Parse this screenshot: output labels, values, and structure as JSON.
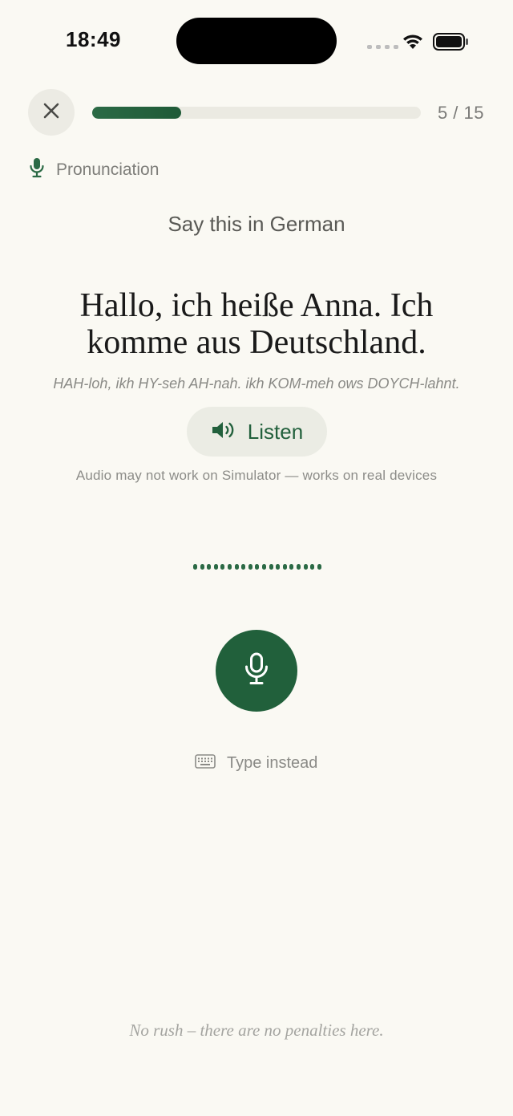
{
  "status_bar": {
    "time": "18:49",
    "icons": [
      "cellular-signal-icon",
      "wifi-icon",
      "battery-icon"
    ]
  },
  "header": {
    "close_icon": "close-icon",
    "progress": {
      "current": 5,
      "total": 15,
      "fraction": 0.27,
      "label": "5 / 15"
    }
  },
  "exercise": {
    "type_icon": "microphone-icon",
    "type_label": "Pronunciation",
    "instruction": "Say this in German",
    "sentence": "Hallo, ich heiße Anna. Ich komme aus Deutschland.",
    "phonetic": "HAH-loh, ikh HY-seh AH-nah. ikh KOM-meh ows DOYCH-lahnt.",
    "listen_icon": "speaker-icon",
    "listen_label": "Listen",
    "audio_note": "Audio may not work on Simulator — works on real devices",
    "record_icon": "microphone-icon",
    "type_instead_icon": "keyboard-icon",
    "type_instead_label": "Type instead"
  },
  "footer": {
    "note": "No rush – there are no penalties here."
  },
  "colors": {
    "background": "#faf9f3",
    "accent": "#21603b",
    "progress_track": "#ebeae2",
    "chip_background": "#ebece4"
  }
}
